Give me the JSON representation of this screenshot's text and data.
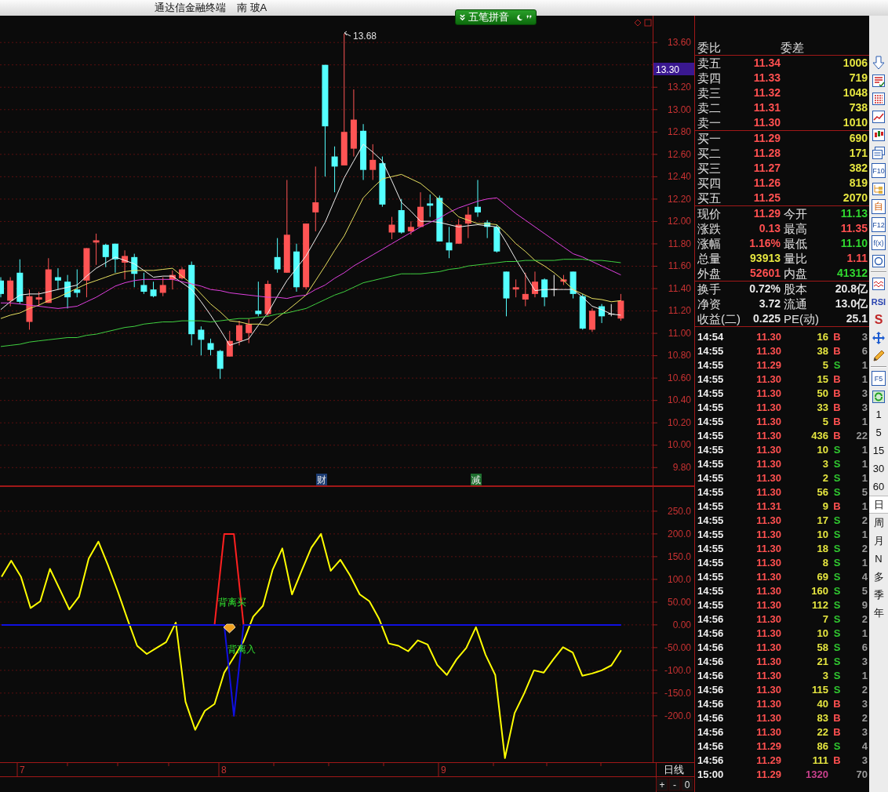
{
  "title_bar": {
    "app_title": "通达信金融终端",
    "stock_name": "南 玻A",
    "input_method": "五笔拼音"
  },
  "main_chart": {
    "high_label": "13.68",
    "cursor_price": "13.30",
    "chart_data": {
      "type": "candlestick",
      "grid": true,
      "ylim": [
        9.63,
        13.84
      ],
      "categories": [
        null,
        null,
        null,
        null,
        null,
        null,
        null,
        null,
        null,
        null,
        null,
        null,
        null,
        null,
        null,
        null,
        null,
        null,
        null,
        null,
        null,
        null,
        null,
        null,
        null,
        null,
        null,
        null,
        null,
        null,
        null,
        null,
        null,
        null,
        null,
        null,
        null,
        null,
        null,
        null,
        null,
        null,
        null,
        null,
        null,
        null,
        null,
        null,
        null,
        null,
        null,
        null,
        null,
        null,
        null,
        null,
        null,
        null,
        null,
        null,
        null,
        null,
        null,
        null,
        null,
        null
      ],
      "yticks": [
        {
          "value": 13.6,
          "label": "13.60"
        },
        {
          "value": 13.2,
          "label": "13.20"
        },
        {
          "value": 13.0,
          "label": "13.00"
        },
        {
          "value": 12.8,
          "label": "12.80"
        },
        {
          "value": 12.6,
          "label": "12.60"
        },
        {
          "value": 12.4,
          "label": "12.40"
        },
        {
          "value": 12.2,
          "label": "12.20"
        },
        {
          "value": 12.0,
          "label": "12.00"
        },
        {
          "value": 11.8,
          "label": "11.80"
        },
        {
          "value": 11.6,
          "label": "11.60"
        },
        {
          "value": 11.4,
          "label": "11.40"
        },
        {
          "value": 11.2,
          "label": "11.20"
        },
        {
          "value": 11.0,
          "label": "11.00"
        },
        {
          "value": 10.8,
          "label": "10.80"
        },
        {
          "value": 10.6,
          "label": "10.60"
        },
        {
          "value": 10.4,
          "label": "10.40"
        },
        {
          "value": 10.2,
          "label": "10.20"
        },
        {
          "value": 10.0,
          "label": "10.00"
        },
        {
          "value": 9.8,
          "label": "9.80"
        }
      ],
      "ohlc": [
        [
          11.47,
          11.5,
          11.32,
          11.35
        ],
        [
          11.29,
          11.5,
          11.24,
          11.47
        ],
        [
          11.54,
          11.66,
          11.26,
          11.28
        ],
        [
          11.1,
          11.39,
          11.03,
          11.33
        ],
        [
          11.3,
          11.37,
          11.24,
          11.32
        ],
        [
          11.27,
          11.67,
          11.27,
          11.57
        ],
        [
          11.5,
          11.58,
          11.39,
          11.47
        ],
        [
          11.46,
          11.52,
          11.22,
          11.32
        ],
        [
          11.39,
          11.57,
          11.32,
          11.36
        ],
        [
          11.47,
          11.76,
          11.32,
          11.76
        ],
        [
          11.81,
          11.89,
          11.61,
          11.83
        ],
        [
          11.79,
          11.8,
          11.59,
          11.68
        ],
        [
          11.8,
          11.8,
          11.54,
          11.66
        ],
        [
          11.63,
          11.74,
          11.48,
          11.69
        ],
        [
          11.68,
          11.71,
          11.41,
          11.53
        ],
        [
          11.43,
          11.54,
          11.35,
          11.37
        ],
        [
          11.39,
          11.46,
          11.32,
          11.33
        ],
        [
          11.36,
          11.5,
          11.33,
          11.43
        ],
        [
          11.48,
          11.56,
          11.39,
          11.52
        ],
        [
          11.49,
          11.59,
          11.48,
          11.57
        ],
        [
          11.61,
          11.64,
          10.89,
          10.99
        ],
        [
          11.03,
          11.06,
          10.8,
          10.94
        ],
        [
          10.91,
          10.95,
          10.8,
          10.85
        ],
        [
          10.84,
          10.85,
          10.59,
          10.68
        ],
        [
          10.79,
          11.02,
          10.79,
          10.93
        ],
        [
          10.93,
          11.11,
          10.89,
          11.07
        ],
        [
          11.0,
          11.13,
          10.91,
          11.08
        ],
        [
          11.2,
          11.46,
          11.15,
          11.17
        ],
        [
          11.17,
          11.47,
          11.15,
          11.44
        ],
        [
          11.68,
          11.85,
          11.54,
          11.57
        ],
        [
          11.54,
          12.37,
          11.54,
          11.88
        ],
        [
          11.73,
          11.8,
          11.37,
          11.41
        ],
        [
          11.41,
          11.98,
          11.39,
          11.98
        ],
        [
          12.08,
          12.49,
          11.91,
          12.17
        ],
        [
          13.4,
          13.4,
          12.4,
          12.85
        ],
        [
          12.58,
          12.67,
          12.26,
          12.49
        ],
        [
          12.5,
          13.68,
          12.5,
          12.8
        ],
        [
          12.65,
          13.18,
          12.58,
          12.91
        ],
        [
          12.81,
          12.87,
          12.37,
          12.46
        ],
        [
          12.46,
          12.69,
          12.37,
          12.55
        ],
        [
          12.52,
          12.58,
          12.13,
          12.15
        ],
        [
          11.9,
          12.04,
          11.84,
          11.97
        ],
        [
          12.1,
          12.2,
          11.89,
          11.9
        ],
        [
          11.91,
          12.0,
          11.88,
          11.95
        ],
        [
          11.95,
          12.26,
          11.95,
          12.13
        ],
        [
          12.16,
          12.24,
          12.04,
          12.14
        ],
        [
          12.21,
          12.23,
          11.82,
          11.82
        ],
        [
          11.81,
          11.95,
          11.67,
          11.74
        ],
        [
          11.8,
          12.02,
          11.8,
          11.97
        ],
        [
          11.98,
          12.13,
          11.85,
          12.06
        ],
        [
          12.13,
          12.37,
          12.04,
          12.08
        ],
        [
          11.99,
          12.01,
          11.85,
          11.95
        ],
        [
          11.95,
          11.97,
          11.72,
          11.73
        ],
        [
          11.55,
          11.55,
          11.15,
          11.31
        ],
        [
          11.39,
          11.48,
          11.32,
          11.41
        ],
        [
          11.3,
          11.54,
          11.24,
          11.35
        ],
        [
          11.35,
          11.55,
          11.32,
          11.46
        ],
        [
          11.48,
          11.49,
          11.24,
          11.32
        ],
        [
          11.39,
          11.52,
          11.33,
          11.39
        ],
        [
          11.46,
          11.52,
          11.43,
          11.48
        ],
        [
          11.55,
          11.55,
          11.31,
          11.35
        ],
        [
          11.33,
          11.35,
          11.03,
          11.04
        ],
        [
          11.03,
          11.22,
          11.01,
          11.2
        ],
        [
          11.24,
          11.26,
          11.09,
          11.15
        ],
        [
          11.17,
          11.26,
          11.15,
          11.17
        ],
        [
          11.13,
          11.35,
          11.11,
          11.29
        ]
      ],
      "series": [
        {
          "type": "line",
          "color": "#f0f0f0",
          "values": [
            11.21,
            11.28,
            11.34,
            11.35,
            11.35,
            11.37,
            11.39,
            11.41,
            11.43,
            11.51,
            11.58,
            11.63,
            11.68,
            11.65,
            11.62,
            11.56,
            11.5,
            11.51,
            11.51,
            11.45,
            11.39,
            11.28,
            11.16,
            11.03,
            10.89,
            10.92,
            10.95,
            11.07,
            11.18,
            11.33,
            11.47,
            11.58,
            11.69,
            11.84,
            11.99,
            12.19,
            12.39,
            12.54,
            12.69,
            12.62,
            12.54,
            12.36,
            12.17,
            12.09,
            12.0,
            12.0,
            11.99,
            11.97,
            11.95,
            11.96,
            11.97,
            11.96,
            11.95,
            11.81,
            11.66,
            11.52,
            11.38,
            11.39,
            11.39,
            11.39,
            11.39,
            11.32,
            11.24,
            11.21,
            11.17,
            11.16
          ]
        },
        {
          "type": "line",
          "color": "#e8e060",
          "values": [
            11.13,
            11.16,
            11.18,
            11.22,
            11.25,
            11.29,
            11.32,
            11.36,
            11.4,
            11.44,
            11.47,
            11.5,
            11.53,
            11.55,
            11.56,
            11.56,
            11.56,
            11.57,
            11.58,
            11.51,
            11.44,
            11.35,
            11.26,
            11.19,
            11.11,
            11.1,
            11.08,
            11.08,
            11.07,
            11.14,
            11.2,
            11.27,
            11.34,
            11.47,
            11.6,
            11.74,
            11.87,
            12.04,
            12.21,
            12.3,
            12.38,
            12.4,
            12.42,
            12.38,
            12.34,
            12.27,
            12.19,
            12.12,
            12.04,
            12.01,
            11.98,
            11.98,
            11.97,
            11.89,
            11.8,
            11.73,
            11.65,
            11.6,
            11.54,
            11.47,
            11.39,
            11.35,
            11.31,
            11.3,
            11.28,
            11.29
          ]
        },
        {
          "type": "line",
          "color": "#e040e0",
          "values": [
            11.27,
            11.27,
            11.26,
            11.25,
            11.24,
            11.23,
            11.22,
            11.23,
            11.24,
            11.28,
            11.32,
            11.37,
            11.42,
            11.45,
            11.47,
            11.48,
            11.48,
            11.48,
            11.48,
            11.46,
            11.44,
            11.42,
            11.39,
            11.38,
            11.36,
            11.35,
            11.34,
            11.33,
            11.32,
            11.32,
            11.31,
            11.33,
            11.34,
            11.39,
            11.43,
            11.49,
            11.54,
            11.6,
            11.65,
            11.7,
            11.75,
            11.8,
            11.85,
            11.9,
            11.95,
            11.99,
            12.03,
            12.08,
            12.12,
            12.15,
            12.18,
            12.2,
            12.21,
            12.14,
            12.07,
            12.01,
            11.95,
            11.89,
            11.83,
            11.77,
            11.71,
            11.68,
            11.64,
            11.6,
            11.56,
            11.52
          ]
        },
        {
          "type": "line",
          "color": "#40d040",
          "values": [
            10.88,
            10.89,
            10.9,
            10.92,
            10.93,
            10.94,
            10.95,
            10.96,
            10.96,
            10.98,
            10.99,
            11.01,
            11.03,
            11.05,
            11.06,
            11.08,
            11.09,
            11.1,
            11.1,
            11.11,
            11.11,
            11.11,
            11.1,
            11.11,
            11.12,
            11.13,
            11.13,
            11.14,
            11.15,
            11.17,
            11.18,
            11.2,
            11.22,
            11.26,
            11.3,
            11.34,
            11.37,
            11.41,
            11.45,
            11.47,
            11.49,
            11.51,
            11.53,
            11.53,
            11.53,
            11.54,
            11.55,
            11.57,
            11.58,
            11.6,
            11.61,
            11.62,
            11.63,
            11.64,
            11.64,
            11.65,
            11.65,
            11.65,
            11.65,
            11.66,
            11.66,
            11.66,
            11.65,
            11.65,
            11.64,
            11.63
          ]
        }
      ]
    },
    "markers": [
      {
        "text": "财",
        "color": "#1c3c72"
      },
      {
        "text": "减",
        "color": "#1e6e2e"
      }
    ]
  },
  "indicator": {
    "chart_data": {
      "type": "line",
      "grid": true,
      "ylim": [
        -302,
        305
      ],
      "categories": [
        null,
        null,
        null,
        null,
        null,
        null,
        null,
        null,
        null,
        null,
        null,
        null,
        null,
        null,
        null,
        null,
        null,
        null,
        null,
        null,
        null,
        null,
        null,
        null,
        null,
        null,
        null,
        null,
        null,
        null,
        null,
        null,
        null,
        null,
        null,
        null,
        null,
        null,
        null,
        null,
        null,
        null,
        null,
        null,
        null,
        null,
        null,
        null,
        null,
        null,
        null,
        null,
        null,
        null,
        null,
        null,
        null,
        null,
        null,
        null,
        null,
        null,
        null,
        null,
        null
      ],
      "yticks": [
        {
          "value": 250,
          "label": "250.0"
        },
        {
          "value": 200,
          "label": "200.0"
        },
        {
          "value": 150,
          "label": "150.0"
        },
        {
          "value": 100,
          "label": "100.0"
        },
        {
          "value": 50,
          "label": "50.00"
        },
        {
          "value": 0,
          "label": "0.00"
        },
        {
          "value": -50,
          "label": "-50.00"
        },
        {
          "value": -100,
          "label": "-100.0"
        },
        {
          "value": -150,
          "label": "-150.0"
        },
        {
          "value": -200,
          "label": "-200.0"
        }
      ],
      "series": [
        {
          "color": "#ffff00",
          "values": [
            106,
            141,
            106,
            37,
            52,
            123,
            79,
            34,
            62,
            146,
            183,
            131,
            74,
            13,
            -46,
            -64,
            -51,
            -38,
            5,
            -169,
            -231,
            -189,
            -174,
            -105,
            -71,
            -36,
            18,
            42,
            121,
            168,
            67,
            119,
            170,
            200,
            119,
            143,
            109,
            67,
            52,
            13,
            -41,
            -46,
            -58,
            -34,
            -43,
            -88,
            -110,
            -76,
            -51,
            -5,
            -66,
            -110,
            -293,
            -194,
            -150,
            -100,
            -105,
            -76,
            -49,
            -61,
            -112,
            -107,
            -100,
            -89,
            -56
          ]
        },
        {
          "color": "#ff2020",
          "values": [
            null,
            null,
            null,
            null,
            null,
            null,
            null,
            null,
            null,
            null,
            null,
            null,
            null,
            null,
            null,
            null,
            null,
            null,
            null,
            null,
            null,
            null,
            0,
            200,
            200,
            0,
            null,
            null,
            null,
            null,
            null,
            null,
            null,
            null,
            null,
            null,
            null,
            null,
            null,
            null,
            null,
            null,
            null,
            null,
            null,
            null,
            null,
            null,
            null,
            null,
            null,
            null,
            null,
            null,
            null,
            null,
            null,
            null,
            null,
            null,
            null,
            null,
            null,
            null,
            null
          ]
        },
        {
          "color": "#1010e0",
          "values": [
            0,
            0,
            0,
            0,
            0,
            0,
            0,
            0,
            0,
            0,
            0,
            0,
            0,
            0,
            0,
            0,
            0,
            0,
            0,
            0,
            0,
            0,
            0,
            0,
            -200,
            0,
            0,
            0,
            0,
            0,
            0,
            0,
            0,
            0,
            0,
            0,
            0,
            0,
            0,
            0,
            0,
            0,
            0,
            0,
            0,
            0,
            0,
            0,
            0,
            0,
            0,
            0,
            0,
            0,
            0,
            0,
            0,
            0,
            0,
            0,
            0,
            0,
            0,
            0,
            0
          ]
        }
      ],
      "annotations": [
        {
          "text": "背离买"
        },
        {
          "text": "背离入"
        }
      ]
    }
  },
  "x_axis": {
    "labels": [
      "7",
      "8",
      "9"
    ],
    "period": "日线",
    "buttons": [
      "+",
      "-",
      "0"
    ]
  },
  "quote": {
    "order_ratio": [
      "委比",
      "委差"
    ],
    "asks": [
      {
        "label": "卖五",
        "price": "11.34",
        "volume": "1006"
      },
      {
        "label": "卖四",
        "price": "11.33",
        "volume": "719"
      },
      {
        "label": "卖三",
        "price": "11.32",
        "volume": "1048"
      },
      {
        "label": "卖二",
        "price": "11.31",
        "volume": "738"
      },
      {
        "label": "卖一",
        "price": "11.30",
        "volume": "1010"
      }
    ],
    "bids": [
      {
        "label": "买一",
        "price": "11.29",
        "volume": "690"
      },
      {
        "label": "买二",
        "price": "11.28",
        "volume": "171"
      },
      {
        "label": "买三",
        "price": "11.27",
        "volume": "382"
      },
      {
        "label": "买四",
        "price": "11.26",
        "volume": "819"
      },
      {
        "label": "买五",
        "price": "11.25",
        "volume": "2070"
      }
    ],
    "stats": [
      {
        "label": "现价",
        "value": "11.29",
        "color": "#ff5050"
      },
      {
        "label": "今开",
        "value": "11.13",
        "color": "#30d830"
      },
      {
        "label": "涨跌",
        "value": "0.13",
        "color": "#ff5050"
      },
      {
        "label": "最高",
        "value": "11.35",
        "color": "#ff5050"
      },
      {
        "label": "涨幅",
        "value": "1.16%",
        "color": "#ff5050"
      },
      {
        "label": "最低",
        "value": "11.10",
        "color": "#30d830"
      },
      {
        "label": "总量",
        "value": "93913",
        "color": "#e6e640"
      },
      {
        "label": "量比",
        "value": "1.11",
        "color": "#ff5050"
      },
      {
        "label": "外盘",
        "value": "52601",
        "color": "#ff5050"
      },
      {
        "label": "内盘",
        "value": "41312",
        "color": "#30d830"
      }
    ],
    "fundamentals": [
      {
        "label": "换手",
        "value": "0.72%",
        "color": "#e8e8e8"
      },
      {
        "label": "股本",
        "value": "20.8亿",
        "color": "#e8e8e8"
      },
      {
        "label": "净资",
        "value": "3.72",
        "color": "#e8e8e8"
      },
      {
        "label": "流通",
        "value": "13.0亿",
        "color": "#e8e8e8"
      },
      {
        "label": "收益(二)",
        "value": "0.225",
        "color": "#e8e8e8"
      },
      {
        "label": "PE(动)",
        "value": "25.1",
        "color": "#e8e8e8"
      }
    ],
    "trades": [
      {
        "time": "14:54",
        "price": "11.30",
        "volume": "16",
        "side": "B",
        "kind": "buy",
        "count": "3"
      },
      {
        "time": "14:55",
        "price": "11.30",
        "volume": "38",
        "side": "B",
        "kind": "buy",
        "count": "6"
      },
      {
        "time": "14:55",
        "price": "11.29",
        "volume": "5",
        "side": "S",
        "kind": "sell",
        "count": "1"
      },
      {
        "time": "14:55",
        "price": "11.30",
        "volume": "15",
        "side": "B",
        "kind": "buy",
        "count": "1"
      },
      {
        "time": "14:55",
        "price": "11.30",
        "volume": "50",
        "side": "B",
        "kind": "buy",
        "count": "3"
      },
      {
        "time": "14:55",
        "price": "11.30",
        "volume": "33",
        "side": "B",
        "kind": "buy",
        "count": "3"
      },
      {
        "time": "14:55",
        "price": "11.30",
        "volume": "5",
        "side": "B",
        "kind": "buy",
        "count": "1"
      },
      {
        "time": "14:55",
        "price": "11.30",
        "volume": "436",
        "side": "B",
        "kind": "buy",
        "count": "22"
      },
      {
        "time": "14:55",
        "price": "11.30",
        "volume": "10",
        "side": "S",
        "kind": "sell",
        "count": "1"
      },
      {
        "time": "14:55",
        "price": "11.30",
        "volume": "3",
        "side": "S",
        "kind": "sell",
        "count": "1"
      },
      {
        "time": "14:55",
        "price": "11.30",
        "volume": "2",
        "side": "S",
        "kind": "sell",
        "count": "1"
      },
      {
        "time": "14:55",
        "price": "11.30",
        "volume": "56",
        "side": "S",
        "kind": "sell",
        "count": "5"
      },
      {
        "time": "14:55",
        "price": "11.31",
        "volume": "9",
        "side": "B",
        "kind": "buy",
        "count": "1"
      },
      {
        "time": "14:55",
        "price": "11.30",
        "volume": "17",
        "side": "S",
        "kind": "sell",
        "count": "2"
      },
      {
        "time": "14:55",
        "price": "11.30",
        "volume": "10",
        "side": "S",
        "kind": "sell",
        "count": "1"
      },
      {
        "time": "14:55",
        "price": "11.30",
        "volume": "18",
        "side": "S",
        "kind": "sell",
        "count": "2"
      },
      {
        "time": "14:55",
        "price": "11.30",
        "volume": "8",
        "side": "S",
        "kind": "sell",
        "count": "1"
      },
      {
        "time": "14:55",
        "price": "11.30",
        "volume": "69",
        "side": "S",
        "kind": "sell",
        "count": "4"
      },
      {
        "time": "14:55",
        "price": "11.30",
        "volume": "160",
        "side": "S",
        "kind": "sell",
        "count": "5"
      },
      {
        "time": "14:55",
        "price": "11.30",
        "volume": "112",
        "side": "S",
        "kind": "sell",
        "count": "9"
      },
      {
        "time": "14:56",
        "price": "11.30",
        "volume": "7",
        "side": "S",
        "kind": "sell",
        "count": "2"
      },
      {
        "time": "14:56",
        "price": "11.30",
        "volume": "10",
        "side": "S",
        "kind": "sell",
        "count": "1"
      },
      {
        "time": "14:56",
        "price": "11.30",
        "volume": "58",
        "side": "S",
        "kind": "sell",
        "count": "6"
      },
      {
        "time": "14:56",
        "price": "11.30",
        "volume": "21",
        "side": "S",
        "kind": "sell",
        "count": "3"
      },
      {
        "time": "14:56",
        "price": "11.30",
        "volume": "3",
        "side": "S",
        "kind": "sell",
        "count": "1"
      },
      {
        "time": "14:56",
        "price": "11.30",
        "volume": "115",
        "side": "S",
        "kind": "sell",
        "count": "2"
      },
      {
        "time": "14:56",
        "price": "11.30",
        "volume": "40",
        "side": "B",
        "kind": "buy",
        "count": "3"
      },
      {
        "time": "14:56",
        "price": "11.30",
        "volume": "83",
        "side": "B",
        "kind": "buy",
        "count": "2"
      },
      {
        "time": "14:56",
        "price": "11.30",
        "volume": "22",
        "side": "B",
        "kind": "buy",
        "count": "3"
      },
      {
        "time": "14:56",
        "price": "11.29",
        "volume": "86",
        "side": "S",
        "kind": "sell",
        "count": "4"
      },
      {
        "time": "14:56",
        "price": "11.29",
        "volume": "111",
        "side": "B",
        "kind": "buy",
        "count": "3"
      },
      {
        "time": "15:00",
        "price": "11.29",
        "volume": "1320",
        "kind": "total",
        "count": "70"
      }
    ]
  },
  "toolbar": {
    "tools": [
      {
        "kind": "arrow-down"
      },
      {
        "kind": "report"
      },
      {
        "kind": "grid"
      },
      {
        "kind": "line-chart"
      },
      {
        "kind": "candles"
      },
      {
        "kind": "windows"
      },
      {
        "kind": "text-box",
        "label": "F10"
      },
      {
        "kind": "tree"
      },
      {
        "kind": "text-box",
        "label": "自"
      },
      {
        "kind": "text-box",
        "label": "F12"
      },
      {
        "kind": "text-box",
        "label": "f(x)"
      },
      {
        "kind": "circle"
      },
      {
        "kind": "separator"
      },
      {
        "kind": "wave"
      },
      {
        "kind": "text",
        "label": "RSI"
      },
      {
        "kind": "logo",
        "label": "S"
      },
      {
        "kind": "move"
      },
      {
        "kind": "pencil"
      },
      {
        "kind": "separator"
      },
      {
        "kind": "text-box",
        "label": "F5"
      },
      {
        "kind": "refresh"
      }
    ],
    "periods": [
      {
        "label": "1",
        "selected": false
      },
      {
        "label": "5",
        "selected": false
      },
      {
        "label": "15",
        "selected": false
      },
      {
        "label": "30",
        "selected": false
      },
      {
        "label": "60",
        "selected": false
      },
      {
        "label": "日",
        "selected": true
      },
      {
        "label": "周",
        "selected": false
      },
      {
        "label": "月",
        "selected": false
      },
      {
        "label": "N",
        "selected": false
      },
      {
        "label": "多",
        "selected": false
      },
      {
        "label": "季",
        "selected": false
      },
      {
        "label": "年",
        "selected": false
      }
    ]
  }
}
